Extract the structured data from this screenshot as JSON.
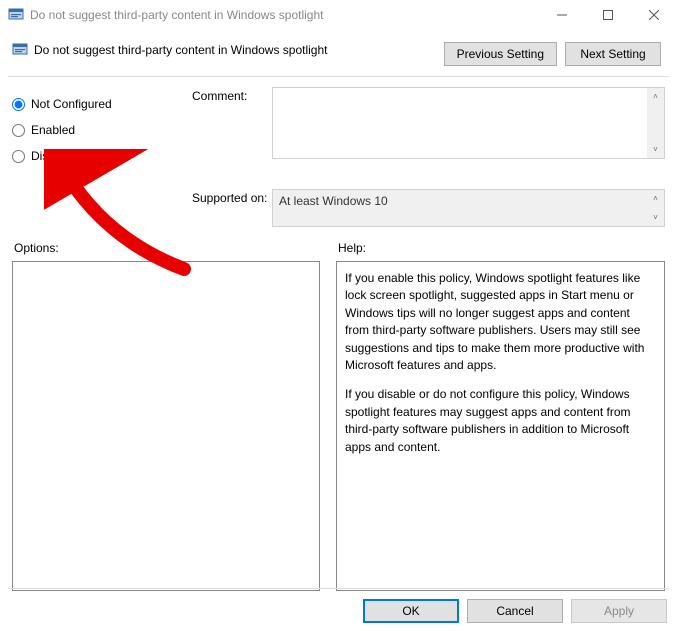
{
  "window": {
    "title": "Do not suggest third-party content in Windows spotlight"
  },
  "header": {
    "policy_name": "Do not suggest third-party content in Windows spotlight",
    "prev_btn": "Previous Setting",
    "next_btn": "Next Setting"
  },
  "state": {
    "not_configured": "Not Configured",
    "enabled": "Enabled",
    "disabled": "Disabled",
    "selected": "not_configured"
  },
  "meta": {
    "comment_label": "Comment:",
    "comment_value": "",
    "supported_label": "Supported on:",
    "supported_value": "At least Windows 10"
  },
  "lower": {
    "options_label": "Options:",
    "help_label": "Help:",
    "help_p1": "If you enable this policy, Windows spotlight features like lock screen spotlight, suggested apps in Start menu or Windows tips will no longer suggest apps and content from third-party software publishers. Users may still see suggestions and tips to make them more productive with Microsoft features and apps.",
    "help_p2": "If you disable or do not configure this policy, Windows spotlight features may suggest apps and content from third-party software publishers in addition to Microsoft apps and content."
  },
  "footer": {
    "ok": "OK",
    "cancel": "Cancel",
    "apply": "Apply"
  }
}
